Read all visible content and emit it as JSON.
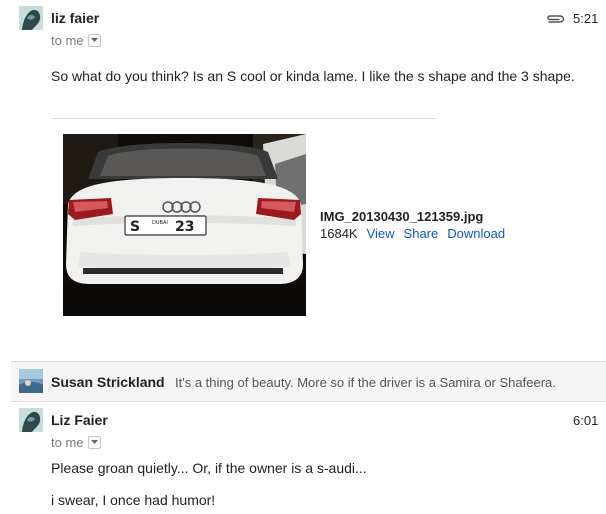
{
  "messages": [
    {
      "sender": "liz faier",
      "recipient": "to me",
      "time": "5:21",
      "body": "So what do you think? Is an S cool or kinda lame. I like the s shape and the 3 shape.",
      "attachment": {
        "filename": "IMG_20130430_121359.jpg",
        "size": "1684K",
        "actions": [
          "View",
          "Share",
          "Download"
        ],
        "plate": {
          "letter": "S",
          "emirate": "DUBAI",
          "number": "23"
        }
      }
    },
    {
      "sender": "Susan Strickland",
      "snippet": "It's a thing of beauty. More so if the driver is a Samira or Shafeera."
    },
    {
      "sender": "Liz Faier",
      "recipient": "to me",
      "time": "6:01",
      "body_lines": [
        "Please groan quietly... Or, if the owner is a s-audi...",
        "i swear, I once had humor!"
      ]
    }
  ]
}
